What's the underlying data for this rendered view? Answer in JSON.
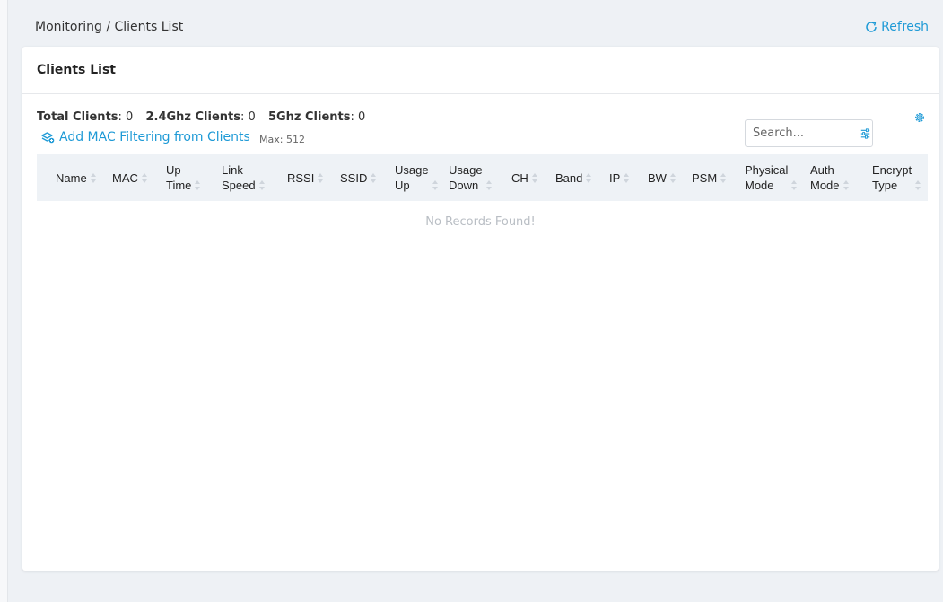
{
  "breadcrumb": "Monitoring / Clients List",
  "refresh_label": "Refresh",
  "card_title": "Clients List",
  "stats": {
    "total_label": "Total Clients",
    "total_value": ": 0",
    "g24_label": "2.4Ghz Clients",
    "g24_value": ": 0",
    "g5_label": "5Ghz Clients",
    "g5_value": ": 0"
  },
  "add_mac_label": "Add MAC Filtering from Clients",
  "max_label": "Max: 512",
  "search_placeholder": "Search...",
  "columns": [
    "Name",
    "MAC",
    "Up\nTime",
    "Link\nSpeed",
    "RSSI",
    "SSID",
    "Usage\nUp",
    "Usage\nDown",
    "CH",
    "Band",
    "IP",
    "BW",
    "PSM",
    "Physical\nMode",
    "Auth\nMode",
    "Encrypt\nType"
  ],
  "empty_message": "No Records Found!",
  "colors": {
    "accent": "#1e9ad6",
    "header_bg": "#eef2f6",
    "page_bg": "#eef1f5"
  },
  "icons": {
    "refresh": "refresh-icon",
    "add_mac": "layers-plus-icon",
    "filter": "sliders-icon",
    "settings": "gear-icon"
  }
}
